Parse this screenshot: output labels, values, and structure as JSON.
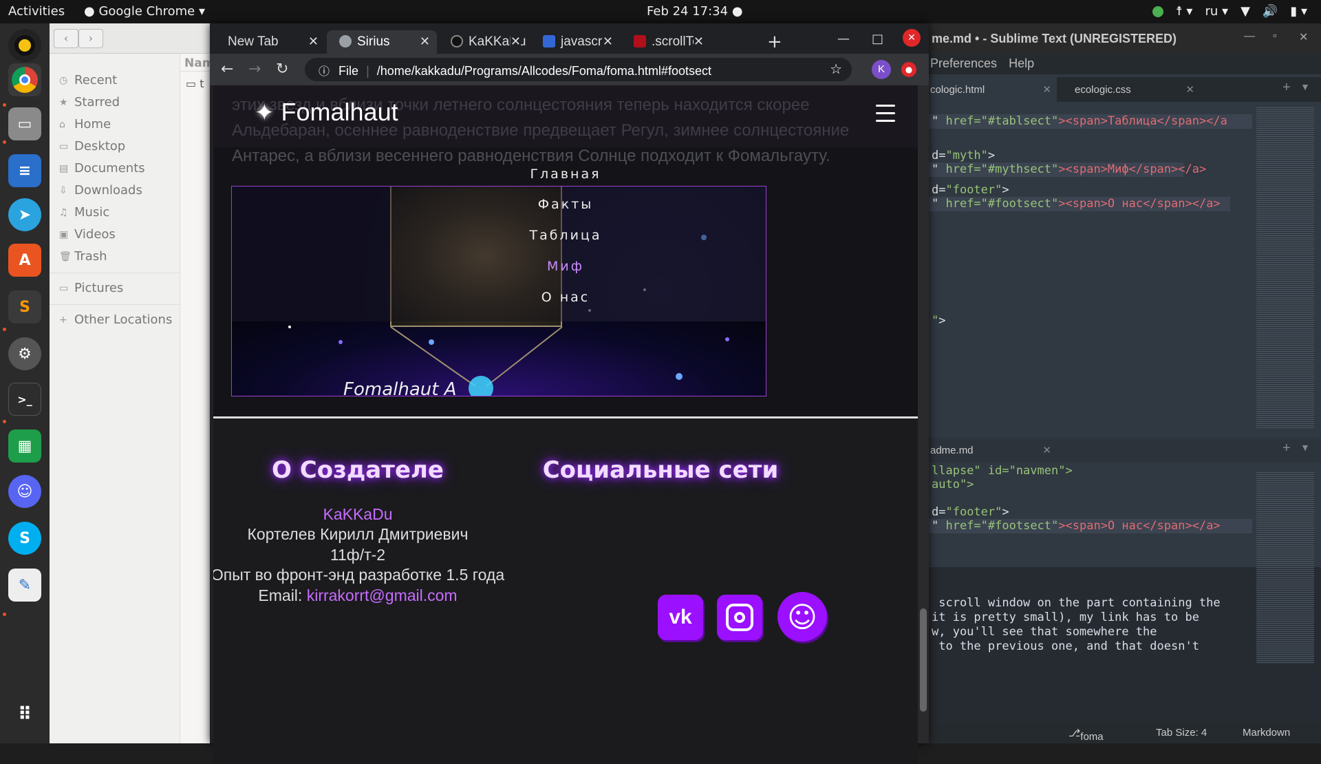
{
  "topbar": {
    "activities": "Activities",
    "app": "Google Chrome",
    "clock": "Feb 24  17:34",
    "lang": "ru"
  },
  "dock": {
    "items": [
      "rhythmbox-icon",
      "chrome-icon",
      "files-icon",
      "writer-icon",
      "telegram-icon",
      "software-icon",
      "sublime-icon",
      "settings-icon",
      "terminal-icon",
      "calc-icon",
      "discord-icon",
      "skype-icon",
      "editor-icon",
      "apps-grid-icon"
    ]
  },
  "files": {
    "column_header": "Nam",
    "sidebar": [
      "Recent",
      "Starred",
      "Home",
      "Desktop",
      "Documents",
      "Downloads",
      "Music",
      "Videos",
      "Trash",
      "Pictures",
      "Other Locations"
    ],
    "row_text": "t"
  },
  "sublime": {
    "title": "me.md • - Sublime Text (UNREGISTERED)",
    "menu": [
      "Preferences",
      "Help"
    ],
    "tabs_top": [
      "cologic.html",
      "ecologic.css"
    ],
    "tabs_bottom": [
      "adme.md"
    ],
    "code_top": [
      {
        "plain": "\" ",
        "attr": "href=",
        "str": "\"#tablsect\"",
        "rest": "><span>Таблица</span></a"
      },
      {
        "plain": "d=",
        "str": "\"myth\"",
        "rest": ">"
      },
      {
        "plain": "\" ",
        "attr": "href=",
        "str": "\"#mythsect\"",
        "rest": "><span>Миф</span></a>"
      },
      {
        "plain": "d=",
        "str": "\"footer\"",
        "rest": ">"
      },
      {
        "plain": "\" ",
        "attr": "href=",
        "str": "\"#footsect\"",
        "rest": "><span>О нас</span></a>"
      },
      {
        "plain": "\"",
        "str": "",
        "rest": ">"
      }
    ],
    "code_bottom": [
      {
        "plain": "llapse\" id=\"navmen\">",
        "str": "",
        "rest": ""
      },
      {
        "plain": "auto\">",
        "str": "",
        "rest": ""
      },
      {
        "plain": "d=",
        "str": "\"footer\"",
        "rest": ">"
      },
      {
        "plain": "\" ",
        "attr": "href=",
        "str": "\"#footsect\"",
        "rest": "><span>О нас</span></a>"
      }
    ],
    "text_lines": [
      " scroll window on the part containing the",
      "it is pretty small), my link has to be",
      "w, you'll see that somewhere the",
      " to the previous one, and that doesn't"
    ],
    "status": {
      "branch": "foma",
      "tab_size": "Tab Size: 4",
      "syntax": "Markdown"
    }
  },
  "chrome": {
    "tabs": [
      {
        "title": "New Tab"
      },
      {
        "title": "Sirius"
      },
      {
        "title": "KaKKaDu"
      },
      {
        "title": "javascrip"
      },
      {
        "title": ".scrollTo"
      }
    ],
    "new_tab": "+",
    "url_prefix": "File",
    "url": "/home/kakkadu/Programs/Allcodes/Foma/foma.html#footsect",
    "profile": "K"
  },
  "site": {
    "bg_paragraph": "этих звезд и вблизи точки летнего солнцестояния теперь находится скорее Альдебаран, осеннее равноденствие предвещает Регул, зимнее солнцестояние Антарес, а вблизи весеннего равноденствия Солнце подходит к Фомальгауту.",
    "brand": "Fomalhaut",
    "nav": [
      "Главная",
      "Факты",
      "Таблица",
      "Миф",
      "О нас"
    ],
    "active_nav": "Миф",
    "image_caption": "Fomalhaut A",
    "footer": {
      "about_title": "О Создателе",
      "nick": "KaKKaDu",
      "name": "Кортелев Кирилл Дмитриевич",
      "class": "11ф/т-2",
      "experience": "Опыт во фронт-энд разработке 1.5 года",
      "email_label": "Email:",
      "email": "kirrakorrt@gmail.com",
      "social_title": "Социальные сети",
      "social": [
        "vk-icon",
        "instagram-icon",
        "github-icon"
      ]
    }
  }
}
